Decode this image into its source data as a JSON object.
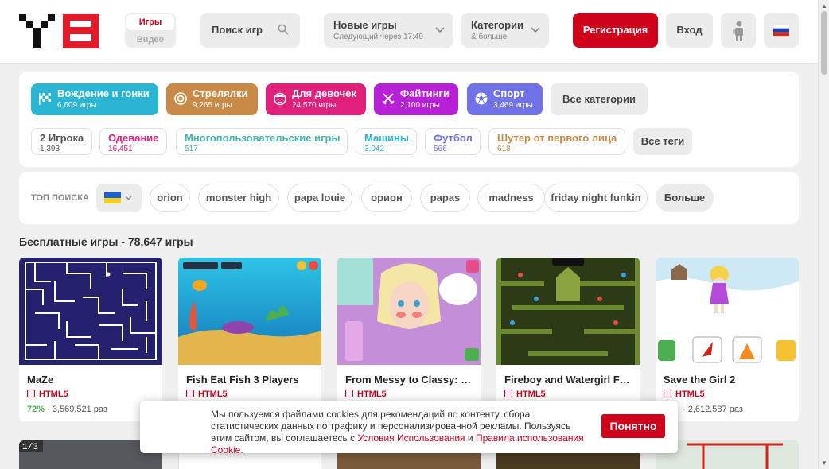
{
  "header": {
    "media_toggle": {
      "games": "Игры",
      "video": "Видео"
    },
    "search_placeholder": "Поиск игр",
    "new_games": {
      "title": "Новые игры",
      "subtitle": "Следующий через 17:49"
    },
    "categories_dd": {
      "title": "Категории",
      "subtitle": "& больше"
    },
    "register": "Регистрация",
    "login": "Вход"
  },
  "categories": [
    {
      "name": "Вождение и гонки",
      "count": "6,609 игры",
      "color": "#2bb5d4"
    },
    {
      "name": "Стрелялки",
      "count": "9,265 игры",
      "color": "#c98a47"
    },
    {
      "name": "Для девочек",
      "count": "24,570 игры",
      "color": "#e0207a"
    },
    {
      "name": "Файтинги",
      "count": "2,100 игры",
      "color": "#b820d8"
    },
    {
      "name": "Спорт",
      "count": "3,469 игры",
      "color": "#7272e8"
    }
  ],
  "categories_all": "Все категории",
  "tags": [
    {
      "name": "2 Игрока",
      "count": "1,393",
      "color": "#555555"
    },
    {
      "name": "Одевание",
      "count": "16,451",
      "color": "#e0207a"
    },
    {
      "name": "Многопользовательские игры",
      "count": "517",
      "color": "#41b8a8"
    },
    {
      "name": "Машины",
      "count": "3,042",
      "color": "#2bb5d4"
    },
    {
      "name": "Футбол",
      "count": "566",
      "color": "#7272e8"
    },
    {
      "name": "Шутер от первого лица",
      "count": "618",
      "color": "#c98a47"
    }
  ],
  "tags_all": "Все теги",
  "top_search": {
    "label": "ТОП ПОИСКА",
    "items": [
      "orion",
      "monster high",
      "papa louie",
      "орион",
      "papas",
      "madness",
      "friday night funkin"
    ],
    "more": "Больше"
  },
  "section_title": "Бесплатные игры - 78,647 игры",
  "games": [
    {
      "title": "MaZe",
      "badge": "HTML5",
      "rating": "72%",
      "plays": "· 3,569,521 раз"
    },
    {
      "title": "Fish Eat Fish 3 Players",
      "badge": "HTML5",
      "rating": "",
      "plays": ""
    },
    {
      "title": "From Messy to Classy: Pr...",
      "badge": "HTML5",
      "rating": "",
      "plays": ""
    },
    {
      "title": "Fireboy and Watergirl For...",
      "badge": "HTML5",
      "rating": "",
      "plays": ""
    },
    {
      "title": "Save the Girl 2",
      "badge": "HTML5",
      "rating": "",
      "plays": "· 2,612,587 раз"
    }
  ],
  "cookie": {
    "text": "Мы пользуемся файлами cookies для рекомендаций по контенту, сбора статистических данных по трафику и персонализированной рекламы. Пользуясь этим сайтом, вы соглашаетесь с ",
    "terms_link": "Условия Использования",
    "and": " и ",
    "cookie_link": "Правила использования Cookie",
    "end": ".",
    "ok": "Понятно"
  },
  "colors": {
    "brand": "#d0021b"
  }
}
